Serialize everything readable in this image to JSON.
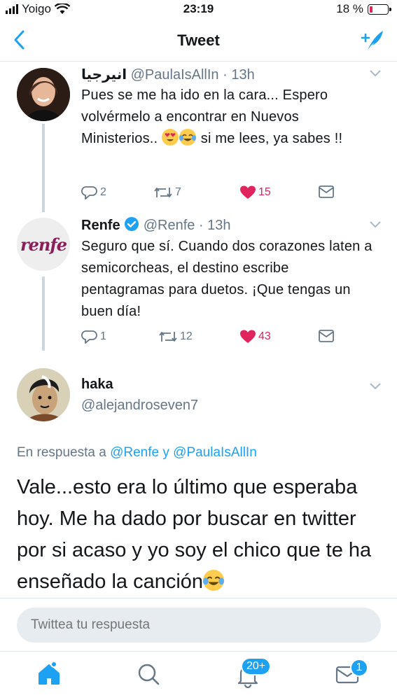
{
  "status_bar": {
    "carrier": "Yoigo",
    "time": "23:19",
    "battery": "18 %",
    "battery_level": 0.18
  },
  "nav": {
    "title": "Tweet"
  },
  "tweets": [
    {
      "name": "انيرجيا",
      "handle": "@PaulaIsAllIn · 13h",
      "text_1": "Pues se me ha ido en la cara... Espero volvérmelo a encontrar en Nuevos Ministerios.. ",
      "text_2": " si me lees, ya sabes !!",
      "emojis": [
        "heart-eyes",
        "tears-of-joy"
      ],
      "replies": "2",
      "retweets": "7",
      "likes": "15",
      "liked": true
    },
    {
      "name": "Renfe",
      "verified": true,
      "handle": "@Renfe · 13h",
      "avatar_text": "renfe",
      "text": "Seguro que sí. Cuando dos corazones laten a semicorcheas, el destino escribe pentagramas para duetos. ¡Que tengas un buen día!",
      "replies": "1",
      "retweets": "12",
      "likes": "43",
      "liked": true
    }
  ],
  "main_tweet": {
    "name": "haka",
    "handle": "@alejandroseven7",
    "reply_prefix": "En respuesta a ",
    "reply_mention_1": "@Renfe",
    "reply_and": " y ",
    "reply_mention_2": "@PaulaIsAllIn",
    "text": "Vale...esto era lo último que esperaba hoy. Me ha dado por buscar en twitter por si acaso y yo soy el chico que te ha enseñado la canción",
    "emoji": "tears-of-joy"
  },
  "reply_box": {
    "placeholder": "Twittea tu respuesta"
  },
  "tab_bar": {
    "notifications_badge": "20+",
    "messages_badge": "1"
  },
  "colors": {
    "accent": "#1da1f2",
    "like": "#e0245e",
    "muted": "#657786",
    "renfe": "#8a1e5a"
  },
  "icons": [
    "back-icon",
    "compose-icon",
    "chevron-down-icon",
    "reply-icon",
    "retweet-icon",
    "heart-icon",
    "dm-icon",
    "verified-icon",
    "home-icon",
    "search-icon",
    "bell-icon",
    "mail-icon"
  ]
}
